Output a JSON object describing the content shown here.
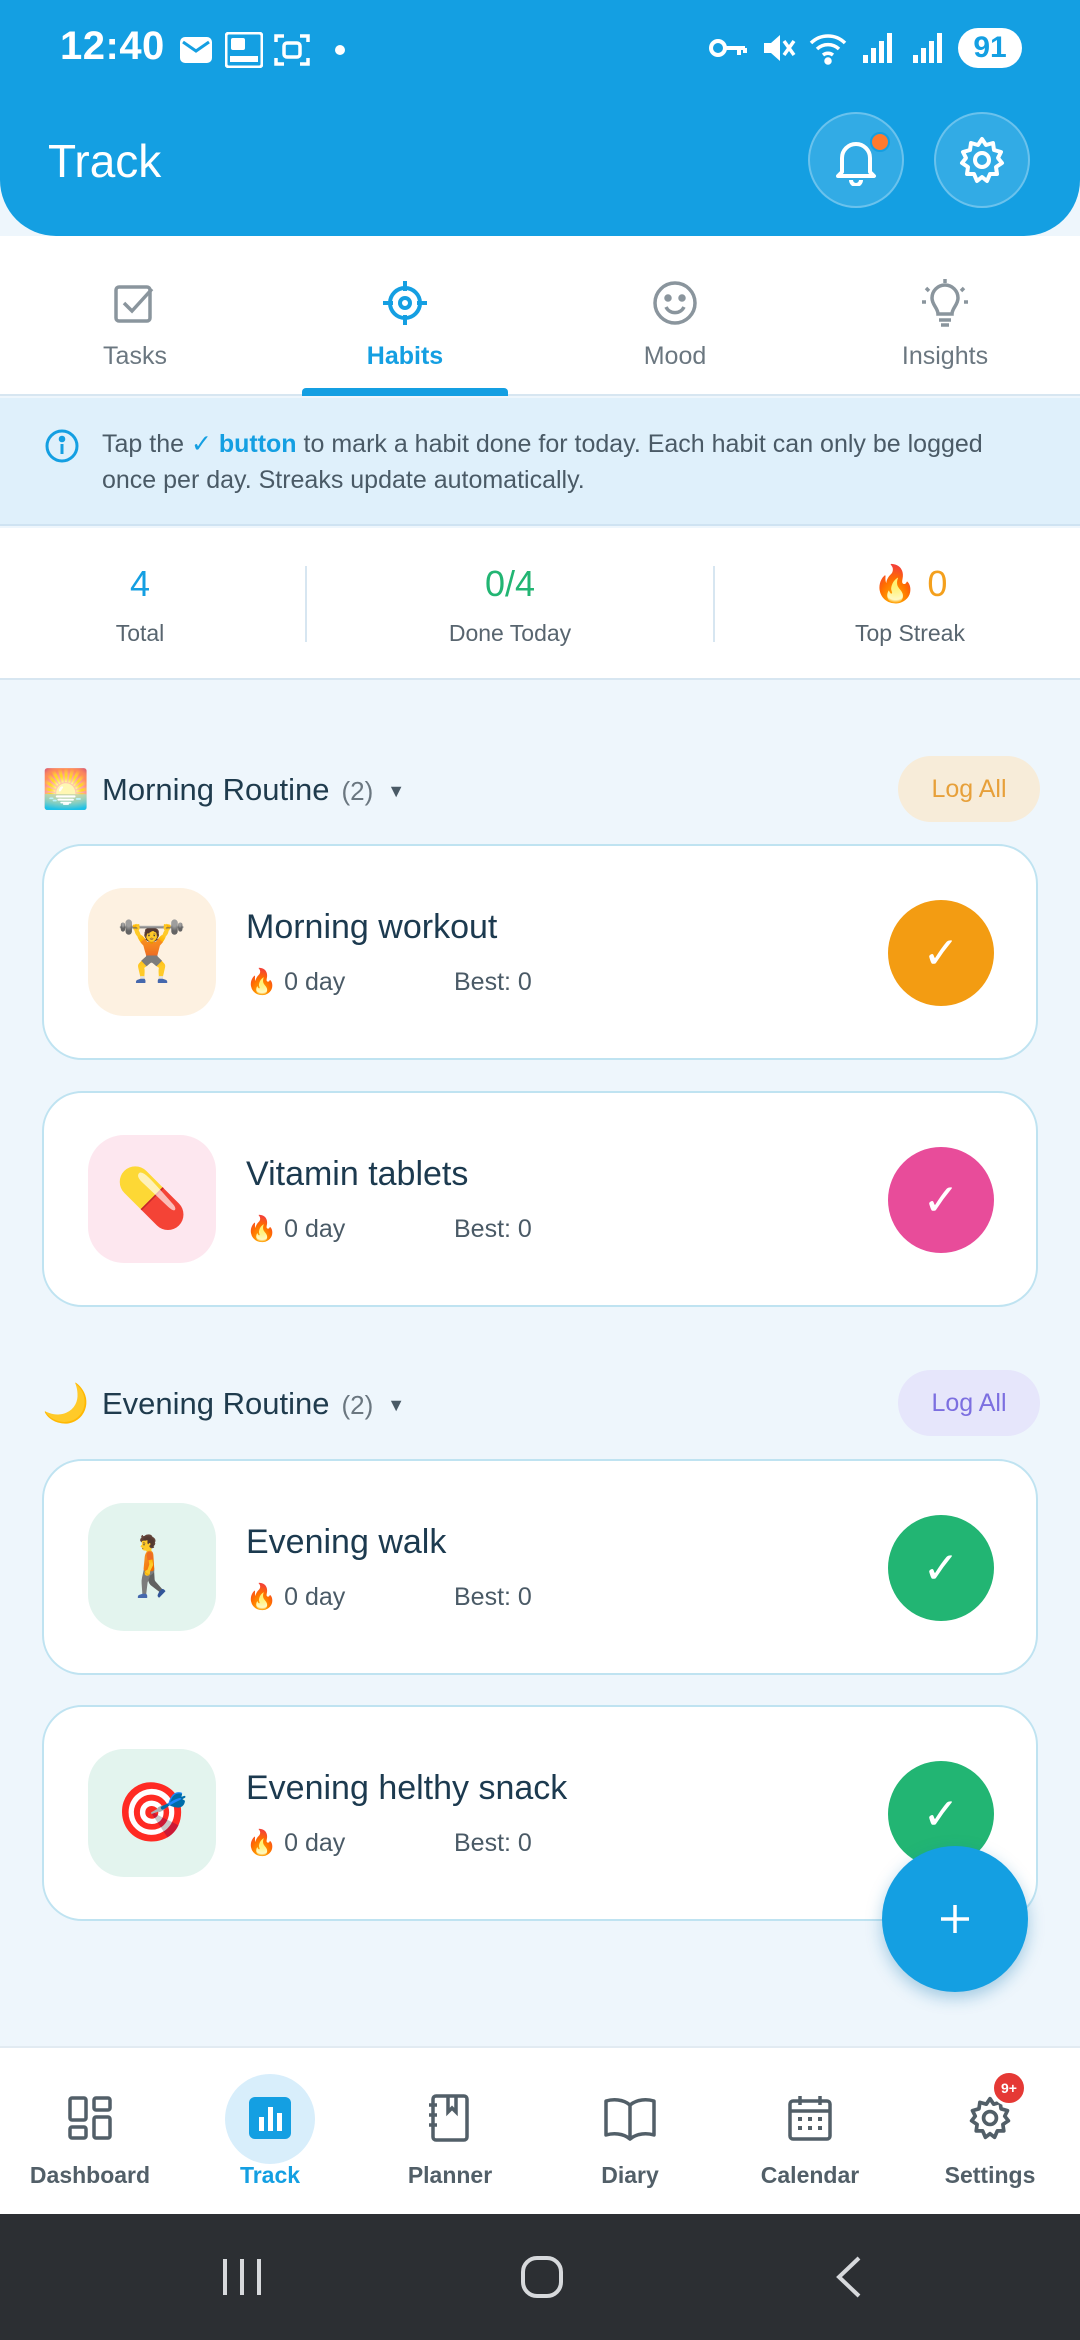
{
  "status_bar": {
    "time": "12:40",
    "battery": "91"
  },
  "header": {
    "title": "Track"
  },
  "tabs": [
    {
      "label": "Tasks",
      "icon": "checkbox-icon"
    },
    {
      "label": "Habits",
      "icon": "target-icon",
      "active": true
    },
    {
      "label": "Mood",
      "icon": "smiley-icon"
    },
    {
      "label": "Insights",
      "icon": "lightbulb-icon"
    }
  ],
  "info": {
    "prefix": "Tap the ",
    "highlight": "✓ button",
    "suffix": " to mark a habit done for today. Each habit can only be logged once per day. Streaks update automatically."
  },
  "stats": {
    "total": {
      "value": "4",
      "label": "Total"
    },
    "done_today": {
      "value": "0/4",
      "label": "Done Today"
    },
    "top_streak": {
      "icon": "🔥",
      "value": "0",
      "label": "Top Streak"
    }
  },
  "groups": [
    {
      "icon": "🌅",
      "title": "Morning Routine",
      "count": "(2)",
      "log_all": "Log All",
      "habits": [
        {
          "emoji": "🏋️",
          "name": "Morning workout",
          "streak": "0 day",
          "best": "Best: 0",
          "check": "✓",
          "color": "#f39c12",
          "tint": "#fdf1e1"
        },
        {
          "emoji": "💊",
          "name": "Vitamin tablets",
          "streak": "0 day",
          "best": "Best: 0",
          "check": "✓",
          "color": "#e84c9a",
          "tint": "#fde7ef"
        }
      ]
    },
    {
      "icon": "🌙",
      "title": "Evening Routine",
      "count": "(2)",
      "log_all": "Log All",
      "habits": [
        {
          "emoji": "🚶",
          "name": "Evening walk",
          "streak": "0 day",
          "best": "Best: 0",
          "check": "✓",
          "color": "#22b573",
          "tint": "#e3f4ee"
        },
        {
          "emoji": "🎯",
          "name": "Evening helthy snack",
          "streak": "0 day",
          "best": "Best: 0",
          "check": "✓",
          "color": "#22b573",
          "tint": "#e3f4ee"
        }
      ]
    }
  ],
  "fab": {
    "label": "+"
  },
  "bottom_nav": [
    {
      "label": "Dashboard",
      "icon": "dashboard-icon"
    },
    {
      "label": "Track",
      "icon": "bar-chart-icon",
      "active": true
    },
    {
      "label": "Planner",
      "icon": "notebook-icon"
    },
    {
      "label": "Diary",
      "icon": "book-icon"
    },
    {
      "label": "Calendar",
      "icon": "calendar-icon"
    },
    {
      "label": "Settings",
      "icon": "gear-icon",
      "badge": "9+"
    }
  ],
  "colors": {
    "primary": "#149fe2",
    "success": "#22b573",
    "warning": "#f4a01d"
  }
}
